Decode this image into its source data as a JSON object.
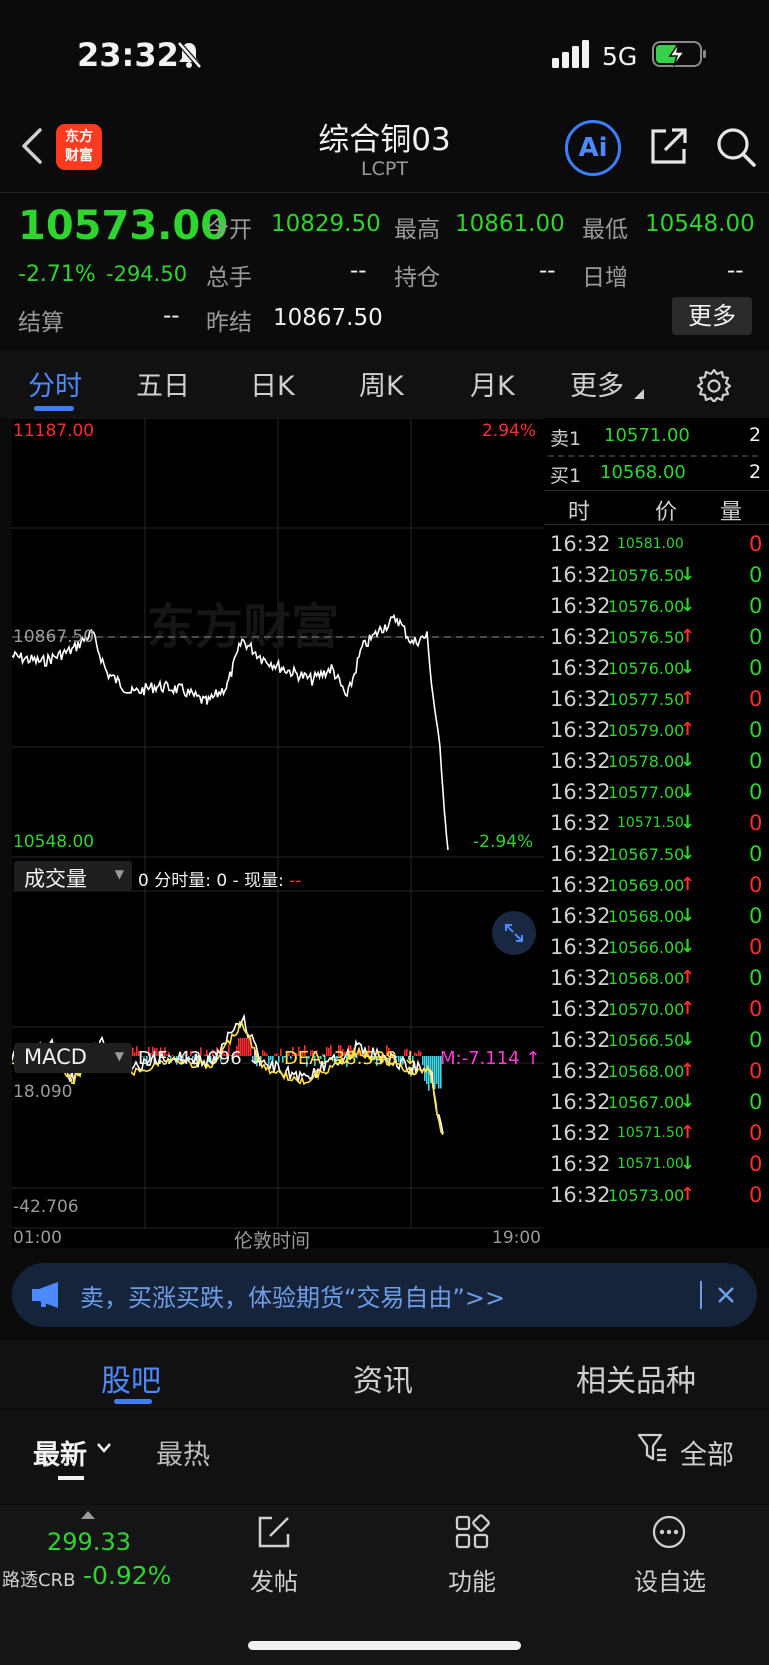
{
  "status_bar": {
    "time": "23:32",
    "network": "5G"
  },
  "header": {
    "logo_line1": "东方",
    "logo_line2": "财富",
    "title": "综合铜03",
    "subtitle": "LCPT",
    "ai_label": "Ai"
  },
  "quote": {
    "price": "10573.00",
    "change_pct": "-2.71%",
    "change": "-294.50",
    "open_label": "今开",
    "open": "10829.50",
    "high_label": "最高",
    "high": "10861.00",
    "low_label": "最低",
    "low": "10548.00",
    "volume_label": "总手",
    "volume": "--",
    "position_label": "持仓",
    "position": "--",
    "daily_inc_label": "日增",
    "daily_inc": "--",
    "settle_label": "结算",
    "settle": "--",
    "prev_settle_label": "昨结",
    "prev_settle": "10867.50",
    "more_label": "更多"
  },
  "tabs": [
    "分时",
    "五日",
    "日K",
    "周K",
    "月K",
    "更多"
  ],
  "chart": {
    "y_max": "11187.00",
    "y_max_pct": "2.94%",
    "ref_price": "10867.50",
    "y_min": "10548.00",
    "y_min_pct": "-2.94%",
    "watermark": "东方财富",
    "volume_selector": "成交量",
    "volume_info_a": "0 分时量: 0 - 现量:",
    "volume_info_b": "--",
    "macd_selector": "MACD",
    "dif": "DIF:-42.096 ↓",
    "dea": "DEA:-38.538 ↓",
    "m": "M:-7.114 ↑",
    "macd_max": "18.090",
    "macd_min": "-42.706",
    "x_start": "01:00",
    "x_mid": "伦敦时间",
    "x_end": "19:00"
  },
  "chart_data": {
    "type": "line",
    "x": [
      "01:00",
      "19:00"
    ],
    "ylim": [
      10548.0,
      11187.0
    ],
    "reference": 10867.5,
    "xlabel": "伦敦时间"
  },
  "order_book": {
    "sell_label": "卖1",
    "sell_price": "10571.00",
    "sell_qty": "2",
    "buy_label": "买1",
    "buy_price": "10568.00",
    "buy_qty": "2",
    "col_time": "时",
    "col_price": "价",
    "col_qty": "量"
  },
  "trades": [
    {
      "time": "16:32",
      "price": "10581.00",
      "dir": "",
      "qty": "0",
      "qcolor": "#ff2d2d",
      "small": true
    },
    {
      "time": "16:32",
      "price": "10576.50",
      "dir": "↓",
      "qty": "0",
      "qcolor": "#2fd52f"
    },
    {
      "time": "16:32",
      "price": "10576.00",
      "dir": "↓",
      "qty": "0",
      "qcolor": "#2fd52f"
    },
    {
      "time": "16:32",
      "price": "10576.50",
      "dir": "↑",
      "qty": "0",
      "qcolor": "#2fd52f"
    },
    {
      "time": "16:32",
      "price": "10576.00",
      "dir": "↓",
      "qty": "0",
      "qcolor": "#2fd52f"
    },
    {
      "time": "16:32",
      "price": "10577.50",
      "dir": "↑",
      "qty": "0",
      "qcolor": "#ff2d2d"
    },
    {
      "time": "16:32",
      "price": "10579.00",
      "dir": "↑",
      "qty": "0",
      "qcolor": "#2fd52f"
    },
    {
      "time": "16:32",
      "price": "10578.00",
      "dir": "↓",
      "qty": "0",
      "qcolor": "#2fd52f"
    },
    {
      "time": "16:32",
      "price": "10577.00",
      "dir": "↓",
      "qty": "0",
      "qcolor": "#2fd52f"
    },
    {
      "time": "16:32",
      "price": "10571.50",
      "dir": "↓",
      "qty": "0",
      "qcolor": "#ff2d2d",
      "small": true
    },
    {
      "time": "16:32",
      "price": "10567.50",
      "dir": "↓",
      "qty": "0",
      "qcolor": "#2fd52f"
    },
    {
      "time": "16:32",
      "price": "10569.00",
      "dir": "↑",
      "qty": "0",
      "qcolor": "#ff2d2d"
    },
    {
      "time": "16:32",
      "price": "10568.00",
      "dir": "↓",
      "qty": "0",
      "qcolor": "#2fd52f"
    },
    {
      "time": "16:32",
      "price": "10566.00",
      "dir": "↓",
      "qty": "0",
      "qcolor": "#ff2d2d"
    },
    {
      "time": "16:32",
      "price": "10568.00",
      "dir": "↑",
      "qty": "0",
      "qcolor": "#2fd52f"
    },
    {
      "time": "16:32",
      "price": "10570.00",
      "dir": "↑",
      "qty": "0",
      "qcolor": "#ff2d2d"
    },
    {
      "time": "16:32",
      "price": "10566.50",
      "dir": "↓",
      "qty": "0",
      "qcolor": "#2fd52f"
    },
    {
      "time": "16:32",
      "price": "10568.00",
      "dir": "↑",
      "qty": "0",
      "qcolor": "#ff2d2d"
    },
    {
      "time": "16:32",
      "price": "10567.00",
      "dir": "↓",
      "qty": "0",
      "qcolor": "#2fd52f"
    },
    {
      "time": "16:32",
      "price": "10571.50",
      "dir": "↑",
      "qty": "0",
      "qcolor": "#ff2d2d",
      "small": true
    },
    {
      "time": "16:32",
      "price": "10571.00",
      "dir": "↓",
      "qty": "0",
      "qcolor": "#ff2d2d",
      "small": true
    },
    {
      "time": "16:32",
      "price": "10573.00",
      "dir": "↑",
      "qty": "0",
      "qcolor": "#ff2d2d"
    }
  ],
  "banner": {
    "text": "卖，买涨买跌，体验期货“交易自由”>>"
  },
  "bottom_tabs": [
    "股吧",
    "资讯",
    "相关品种"
  ],
  "filter": {
    "latest": "最新",
    "hot": "最热",
    "all": "全部"
  },
  "bottom_nav": {
    "ticker_value": "299.33",
    "ticker_name": "路透CRB",
    "ticker_change": "-0.92%",
    "post_label": "发帖",
    "func_label": "功能",
    "watch_label": "设自选"
  }
}
